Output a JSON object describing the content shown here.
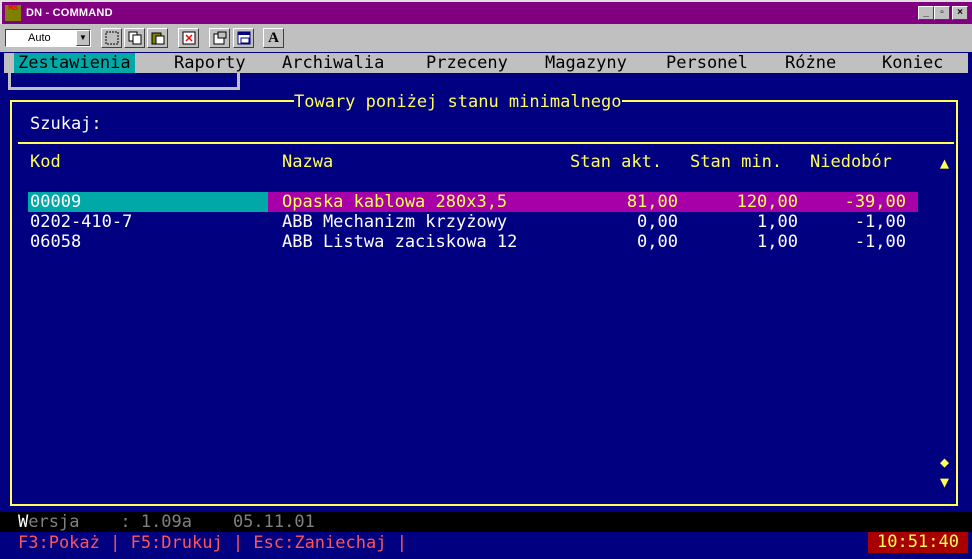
{
  "window": {
    "title": "DN - COMMAND",
    "app_icon_text": "MS",
    "buttons": {
      "minimize": "_",
      "maximize": "▫",
      "close": "×"
    }
  },
  "toolbar": {
    "font_value": "Auto",
    "font_label_button": "A"
  },
  "menu": {
    "items": [
      {
        "label": "Zestawienia",
        "active": true
      },
      {
        "label": "Raporty"
      },
      {
        "label": "Archiwalia"
      },
      {
        "label": "Przeceny"
      },
      {
        "label": "Magazyny"
      },
      {
        "label": "Personel"
      },
      {
        "label": "Różne"
      },
      {
        "label": "Koniec"
      }
    ]
  },
  "panel": {
    "title": "Towary poniżej stanu minimalnego",
    "search_label": "Szukaj:",
    "search_value": "",
    "columns": {
      "code": "Kod",
      "name": "Nazwa",
      "stock": "Stan akt.",
      "min": "Stan min.",
      "shortage": "Niedobór"
    },
    "rows": [
      {
        "code": "00009",
        "name": "Opaska kablowa 280x3,5",
        "stock": "81,00",
        "min": "120,00",
        "shortage": "-39,00"
      },
      {
        "code": "0202-410-7",
        "name": "ABB Mechanizm krzyżowy",
        "stock": "0,00",
        "min": "1,00",
        "shortage": "-1,00"
      },
      {
        "code": "06058",
        "name": "ABB Listwa zaciskowa 12",
        "stock": "0,00",
        "min": "1,00",
        "shortage": "-1,00"
      }
    ],
    "scroll": {
      "up": "▲",
      "mid": "◆",
      "down": "▼"
    }
  },
  "status": {
    "version_first": "W",
    "version_rest": "ersja    : 1.09a    05.11.01",
    "fkeys": "F3:Pokaż | F5:Drukuj | Esc:Zaniechaj |",
    "clock": "10:51:40"
  },
  "colors": {
    "console_bg": "#000080",
    "title_bg": "#800080",
    "highlight_cyan": "#00a8a8",
    "highlight_magenta": "#a800a8",
    "text_yellow": "#ffff55",
    "fkey_red": "#ff5555",
    "clock_bg": "#a80000"
  }
}
